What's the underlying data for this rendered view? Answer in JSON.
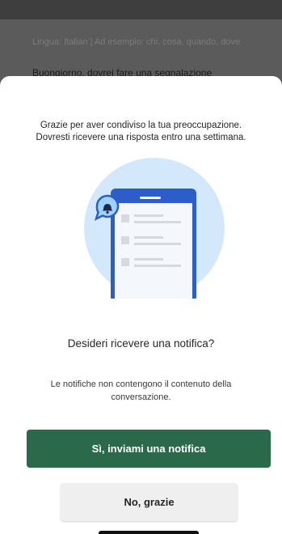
{
  "background": {
    "hint": "Lingua: Italian | Ad esempio: chi, cosa, quando, dove",
    "message": "Buongiorno, dovrei fare una segnalazione"
  },
  "sheet": {
    "intro_line1": "Grazie per aver condiviso la tua preoccupazione.",
    "intro_line2": "Dovresti ricevere una risposta entro una settimana.",
    "illustration_icon": "phone-notification-illustration",
    "question": "Desideri ricevere una notifica?",
    "note": "Le notifiche non contengono il contenuto della conversazione.",
    "yes_button": "Sì, inviami una notifica",
    "no_button": "No, grazie"
  },
  "colors": {
    "primary": "#2a6a4b",
    "secondary_button": "#efefef",
    "illustration_circle": "#d4e8fb",
    "phone": "#2b5fc7",
    "notification_bubble": "#9fd2ff"
  }
}
